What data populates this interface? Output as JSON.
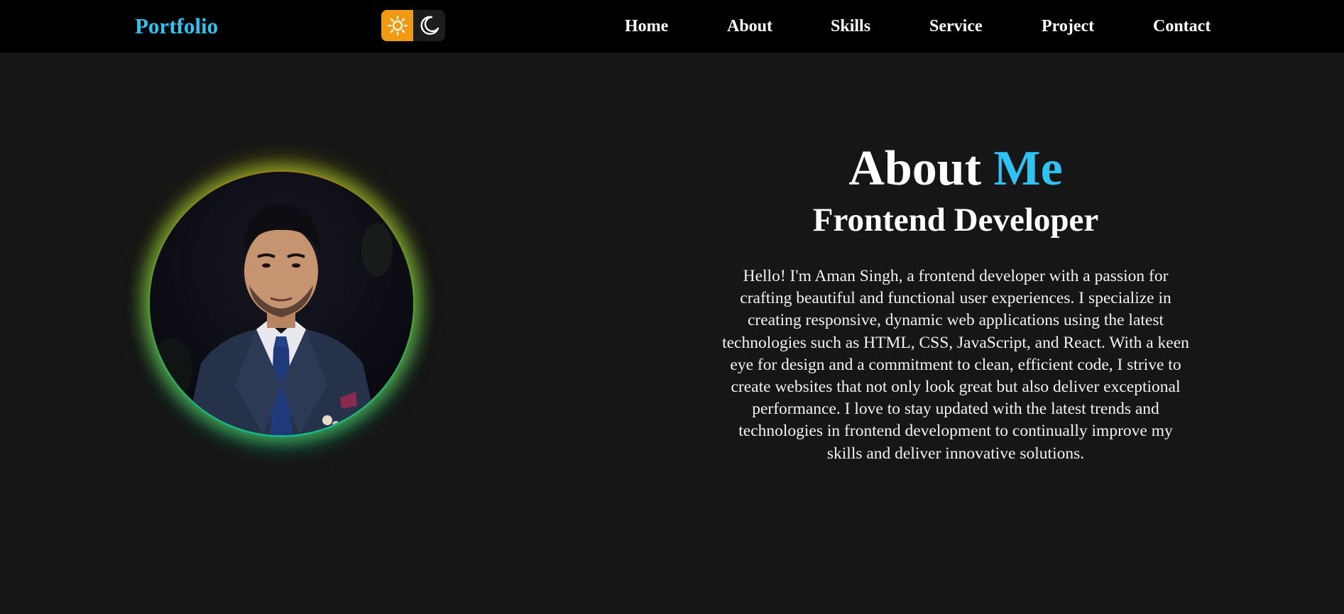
{
  "navbar": {
    "brand": "Portfolio",
    "theme_toggle": {
      "light_icon": "sun-icon",
      "dark_icon": "moon-icon",
      "active": "light",
      "light_color": "#ef9a12"
    },
    "links": [
      {
        "label": "Home"
      },
      {
        "label": "About"
      },
      {
        "label": "Skills"
      },
      {
        "label": "Service"
      },
      {
        "label": "Project"
      },
      {
        "label": "Contact"
      }
    ]
  },
  "about": {
    "title_prefix": "About",
    "title_accent": "Me",
    "subtitle": "Frontend Developer",
    "description": "Hello! I'm Aman Singh, a frontend developer with a passion for crafting beautiful and functional user experiences. I specialize in creating responsive, dynamic web applications using the latest technologies such as HTML, CSS, JavaScript, and React. With a keen eye for design and a commitment to clean, efficient code, I strive to create websites that not only look great but also deliver exceptional performance. I love to stay updated with the latest trends and technologies in frontend development to continually improve my skills and deliver innovative solutions.",
    "profile_image": "profile-photo"
  },
  "colors": {
    "accent": "#2fc3f3",
    "background": "#161616",
    "navbar": "#000000"
  }
}
